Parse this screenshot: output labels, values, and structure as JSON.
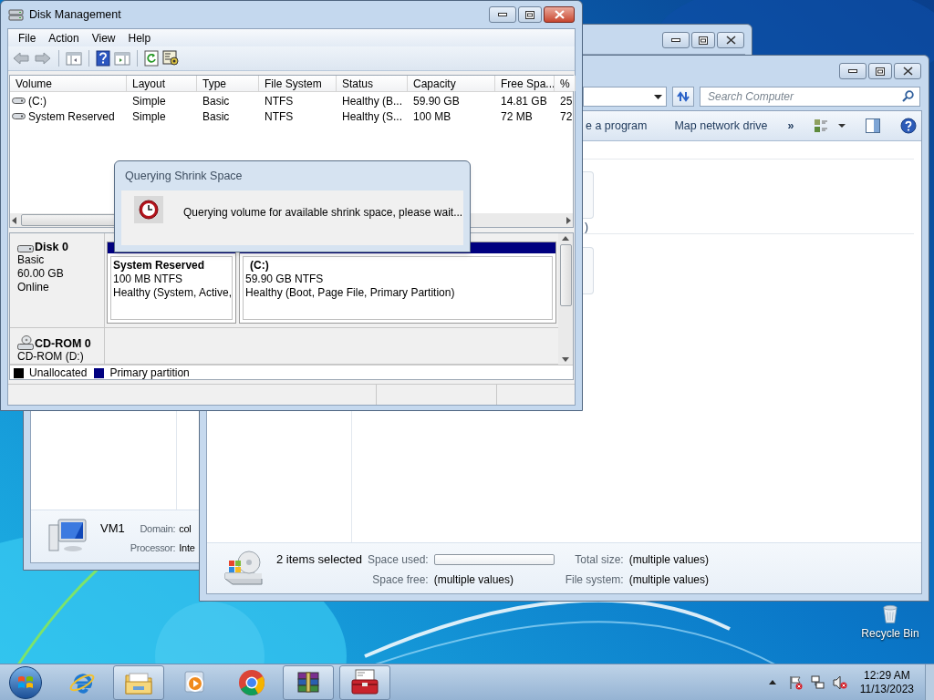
{
  "system_window": {
    "computer_name": "VM1",
    "fields": [
      {
        "label": "Domain:",
        "value": "col"
      },
      {
        "label": "Processor:",
        "value": "Inte"
      }
    ]
  },
  "computer_window": {
    "search": {
      "placeholder": "Search Computer"
    },
    "toolbar": [
      "e a program",
      "Map network drive",
      "»"
    ],
    "group_heading_fragment": ")",
    "details": {
      "summary": "2 items selected",
      "space_used_label": "Space used:",
      "total_size_label": "Total size:",
      "total_size": "(multiple values)",
      "space_free_label": "Space free:",
      "space_free": "(multiple values)",
      "file_system_label": "File system:",
      "file_system": "(multiple values)"
    }
  },
  "disk_management": {
    "title": "Disk Management",
    "menu": [
      "File",
      "Action",
      "View",
      "Help"
    ],
    "volume_table": {
      "columns": [
        "Volume",
        "Layout",
        "Type",
        "File System",
        "Status",
        "Capacity",
        "Free Spa...",
        "%"
      ],
      "rows": [
        {
          "cells": [
            "(C:)",
            "Simple",
            "Basic",
            "NTFS",
            "Healthy (B...",
            "59.90 GB",
            "14.81 GB",
            "25"
          ]
        },
        {
          "cells": [
            "System Reserved",
            "Simple",
            "Basic",
            "NTFS",
            "Healthy (S...",
            "100 MB",
            "72 MB",
            "72"
          ]
        }
      ]
    },
    "disks": [
      {
        "kind": "disk",
        "name": "Disk 0",
        "lines": [
          "Basic",
          "60.00 GB",
          "Online"
        ],
        "partitions": [
          {
            "name": "System Reserved",
            "size": "100 MB NTFS",
            "status": "Healthy (System, Active,"
          },
          {
            "name": "(C:)",
            "size": "59.90 GB NTFS",
            "status": "Healthy (Boot, Page File, Primary Partition)"
          }
        ]
      },
      {
        "kind": "cdrom",
        "name": "CD-ROM 0",
        "lines": [
          "CD-ROM (D:)"
        ]
      }
    ],
    "legend": [
      {
        "label": "Unallocated",
        "color": "#000000"
      },
      {
        "label": "Primary partition",
        "color": "#000080"
      }
    ]
  },
  "dialog": {
    "title": "Querying Shrink Space",
    "message": "Querying volume for available shrink space, please wait..."
  },
  "desktop_icons": [
    {
      "label": "Recycle Bin"
    }
  ],
  "taskbar": {
    "apps": [
      {
        "kind": "ie",
        "running": false
      },
      {
        "kind": "explorer",
        "running": true
      },
      {
        "kind": "media",
        "running": false
      },
      {
        "kind": "chrome",
        "running": false
      },
      {
        "kind": "archive",
        "running": true
      },
      {
        "kind": "toolbox",
        "running": true
      }
    ],
    "clock": {
      "time": "12:29 AM",
      "date": "11/13/2023"
    }
  }
}
